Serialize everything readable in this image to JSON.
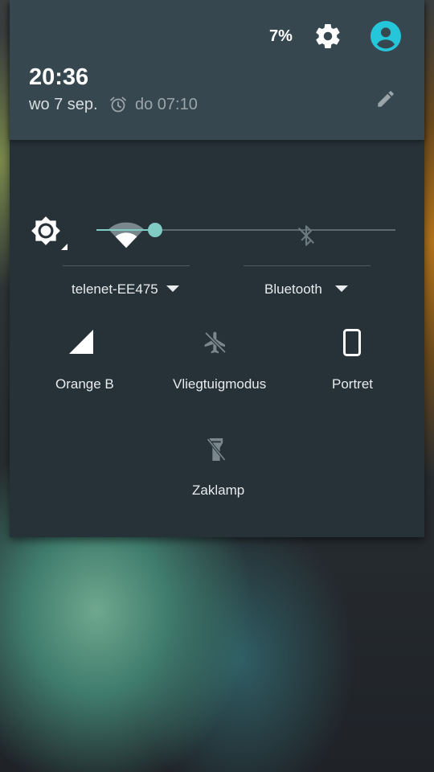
{
  "status": {
    "battery_pct": "7%"
  },
  "header": {
    "time": "20:36",
    "date": "wo 7 sep.",
    "alarm": "do 07:10"
  },
  "tiles": {
    "wifi": {
      "label": "telenet-EE475"
    },
    "bluetooth": {
      "label": "Bluetooth"
    },
    "mobile": {
      "label": "Orange B"
    },
    "airplane": {
      "label": "Vliegtuigmodus"
    },
    "rotation": {
      "label": "Portret"
    },
    "flashlight": {
      "label": "Zaklamp"
    }
  },
  "brightness": {
    "level": 0.2
  },
  "colors": {
    "accent": "#80cbc4",
    "panel": "#263238",
    "header": "#37474f",
    "avatar": "#26c6da"
  }
}
